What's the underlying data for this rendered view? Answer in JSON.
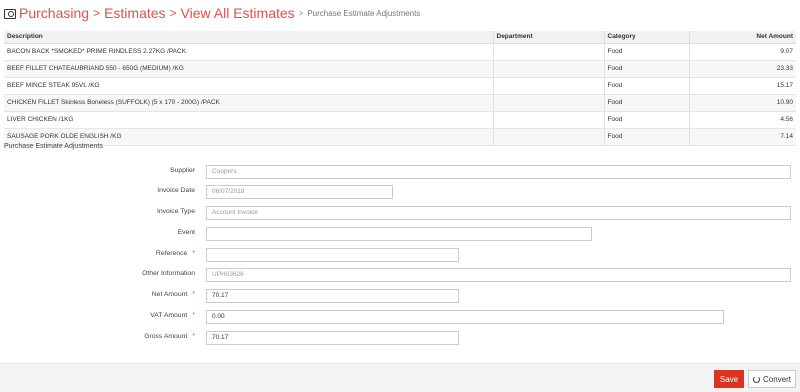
{
  "breadcrumb": {
    "icon": "camera-icon",
    "items": [
      "Purchasing",
      "Estimates",
      "View All Estimates"
    ],
    "separator": ">",
    "current": "Purchase Estimate Adjustments"
  },
  "table": {
    "headers": [
      "Description",
      "Department",
      "Category",
      "Net Amount"
    ],
    "rows": [
      [
        "BACON BACK *SMOKED* PRIME RINDLESS 2.27KG /PACK",
        "",
        "Food",
        "9.07"
      ],
      [
        "BEEF FILLET CHATEAUBRIAND 550 - 650G (MEDIUM) /KG",
        "",
        "Food",
        "23.33"
      ],
      [
        "BEEF MINCE STEAK 95VL /KG",
        "",
        "Food",
        "15.17"
      ],
      [
        "CHICKEN FILLET Skinless Boneless (SUFFOLK) (5 x 170 - 200G) /PACK",
        "",
        "Food",
        "10.90"
      ],
      [
        "LIVER CHICKEN /1KG",
        "",
        "Food",
        "4.56"
      ],
      [
        "SAUSAGE PORK OLDE ENGLISH /KG",
        "",
        "Food",
        "7.14"
      ]
    ]
  },
  "section_title": "Purchase Estimate Adjustments",
  "form": {
    "supplier": {
      "label": "Supplier",
      "value": "Coopers"
    },
    "invoice_date": {
      "label": "Invoice Date",
      "value": "06/07/2018"
    },
    "invoice_type": {
      "label": "Invoice Type",
      "value": "Account Invoice"
    },
    "event": {
      "label": "Event",
      "value": ""
    },
    "reference": {
      "label": "Reference",
      "value": ""
    },
    "other_information": {
      "label": "Other Information",
      "value": "UPH03626"
    },
    "net_amount": {
      "label": "Net Amount",
      "value": "70.17"
    },
    "vat_amount": {
      "label": "VAT Amount",
      "value": "0.00"
    },
    "gross_amount": {
      "label": "Gross Amount",
      "value": "70.17"
    },
    "required_marker": "*"
  },
  "footer": {
    "save_label": "Save",
    "convert_label": "Convert",
    "convert_icon": "refresh-icon"
  },
  "colors": {
    "accent": "#d9534f",
    "save_bg": "#d9341f"
  }
}
